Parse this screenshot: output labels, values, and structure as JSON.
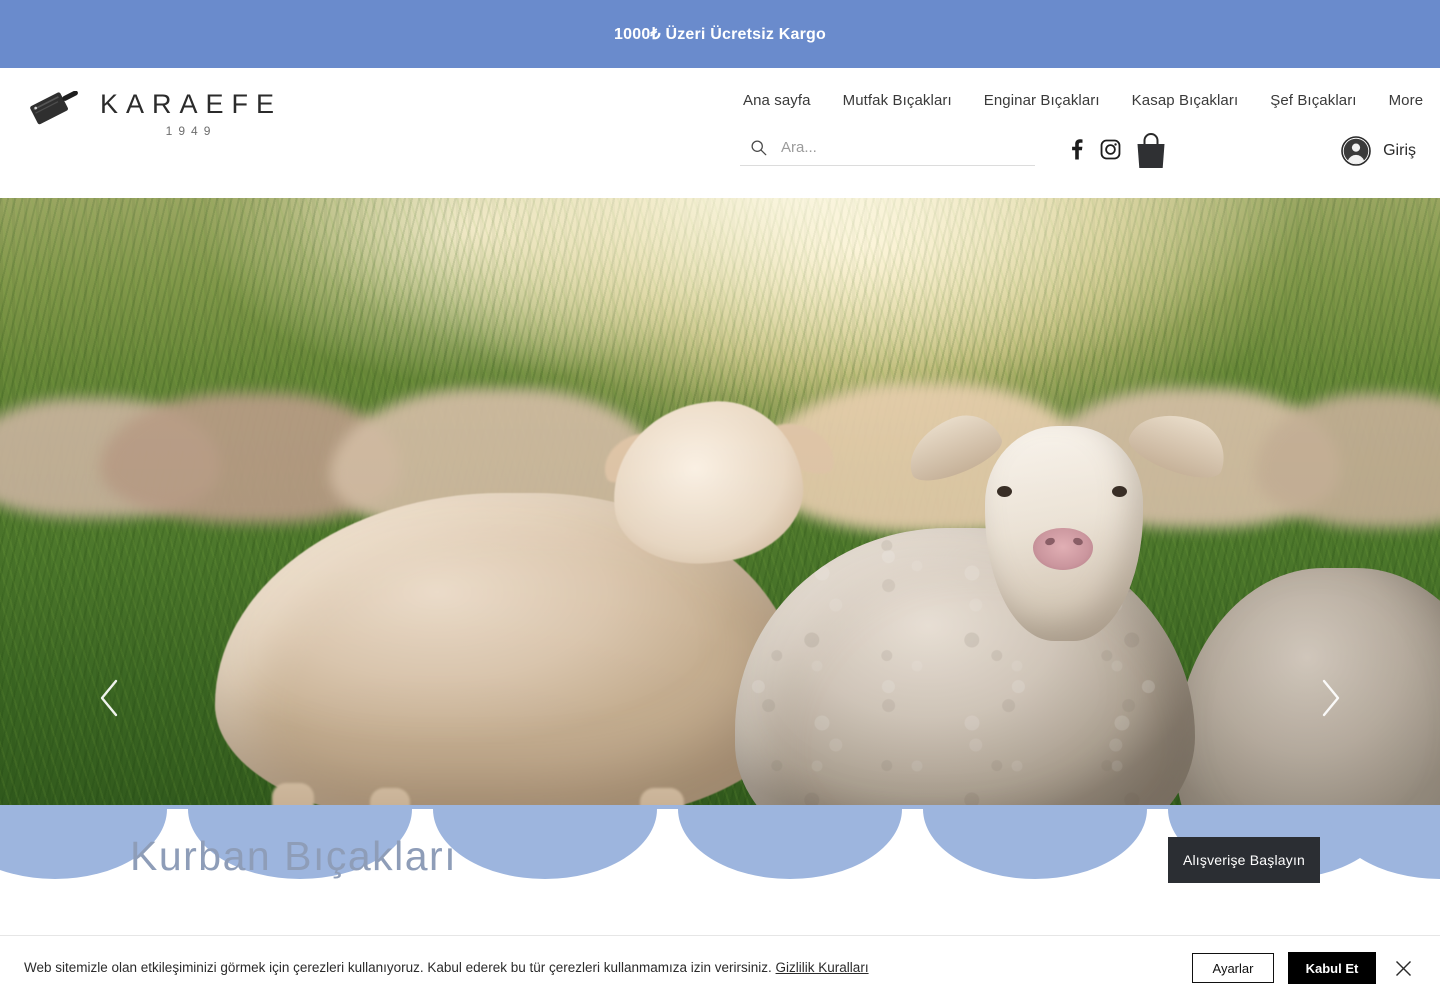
{
  "promo": {
    "text": "1000₺ Üzeri Ücretsiz Kargo",
    "bg_color": "#6A8BCC"
  },
  "brand": {
    "name": "KARAEFE",
    "year": "1949",
    "icon": "cleaver-icon"
  },
  "nav": {
    "items": [
      {
        "label": "Ana sayfa"
      },
      {
        "label": "Mutfak Bıçakları"
      },
      {
        "label": "Enginar Bıçakları"
      },
      {
        "label": "Kasap Bıçakları"
      },
      {
        "label": "Şef Bıçakları"
      },
      {
        "label": "More"
      }
    ]
  },
  "search": {
    "placeholder": "Ara...",
    "value": "",
    "icon": "search-icon"
  },
  "social": [
    {
      "name": "facebook-icon"
    },
    {
      "name": "instagram-icon"
    }
  ],
  "cart": {
    "icon": "shopping-bag-icon"
  },
  "account": {
    "label": "Giriş",
    "icon": "user-avatar-icon"
  },
  "hero": {
    "prev_icon": "chevron-left-icon",
    "next_icon": "chevron-right-icon",
    "slide_count": 5,
    "active_slide": 3,
    "image_description": "Flock of sheep grazing in a sunlit green pasture"
  },
  "promo_section": {
    "title": "Kurban Bıçakları",
    "button_label": "Alışverişe Başlayın",
    "scallop_color": "#9DB5DE",
    "title_color": "#8E9DB8",
    "button_bg": "#2B2E33",
    "scallop_count": 7
  },
  "cookie": {
    "message": "Web sitemizle olan etkileşiminizi görmek için çerezleri kullanıyoruz. Kabul ederek bu tür çerezleri kullanmamıza izin verirsiniz.",
    "link_label": "Gizlilik Kuralları",
    "settings_label": "Ayarlar",
    "accept_label": "Kabul Et",
    "close_icon": "close-icon"
  }
}
